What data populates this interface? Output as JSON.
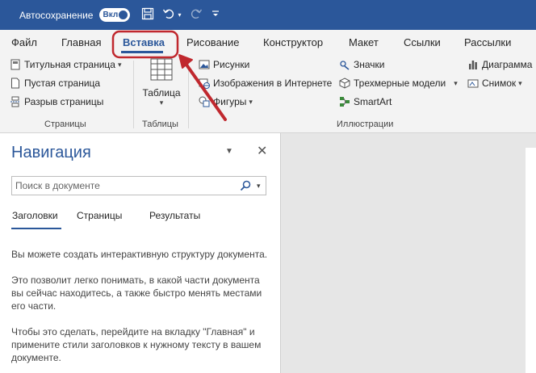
{
  "titlebar": {
    "autosave_label": "Автосохранение",
    "autosave_toggle": "Вкл",
    "icons": [
      "save-icon",
      "undo-icon",
      "redo-icon",
      "customize-qat-icon"
    ]
  },
  "tabs": [
    {
      "label": "Файл"
    },
    {
      "label": "Главная"
    },
    {
      "label": "Вставка",
      "active": true
    },
    {
      "label": "Рисование"
    },
    {
      "label": "Конструктор"
    },
    {
      "label": "Макет"
    },
    {
      "label": "Ссылки"
    },
    {
      "label": "Рассылки"
    }
  ],
  "ribbon": {
    "pages": {
      "label": "Страницы",
      "items": [
        "Титульная страница",
        "Пустая страница",
        "Разрыв страницы"
      ]
    },
    "tables": {
      "label": "Таблицы",
      "table": "Таблица"
    },
    "illustrations": {
      "label": "Иллюстрации",
      "pictures": "Рисунки",
      "online_pictures": "Изображения в Интернете",
      "shapes": "Фигуры",
      "icons": "Значки",
      "models3d": "Трехмерные модели",
      "smartart": "SmartArt",
      "chart": "Диаграмма",
      "screenshot": "Снимок"
    }
  },
  "nav": {
    "title": "Навигация",
    "search_placeholder": "Поиск в документе",
    "tabs": [
      "Заголовки",
      "Страницы",
      "Результаты"
    ],
    "para1": "Вы можете создать интерактивную структуру документа.",
    "para2": "Это позволит легко понимать, в какой части документа вы сейчас находитесь, а также быстро менять местами его части.",
    "para3": "Чтобы это сделать, перейдите на вкладку \"Главная\" и примените стили заголовков к нужному тексту в вашем документе."
  },
  "colors": {
    "accent": "#2b579a",
    "annotation": "#c0282e"
  }
}
